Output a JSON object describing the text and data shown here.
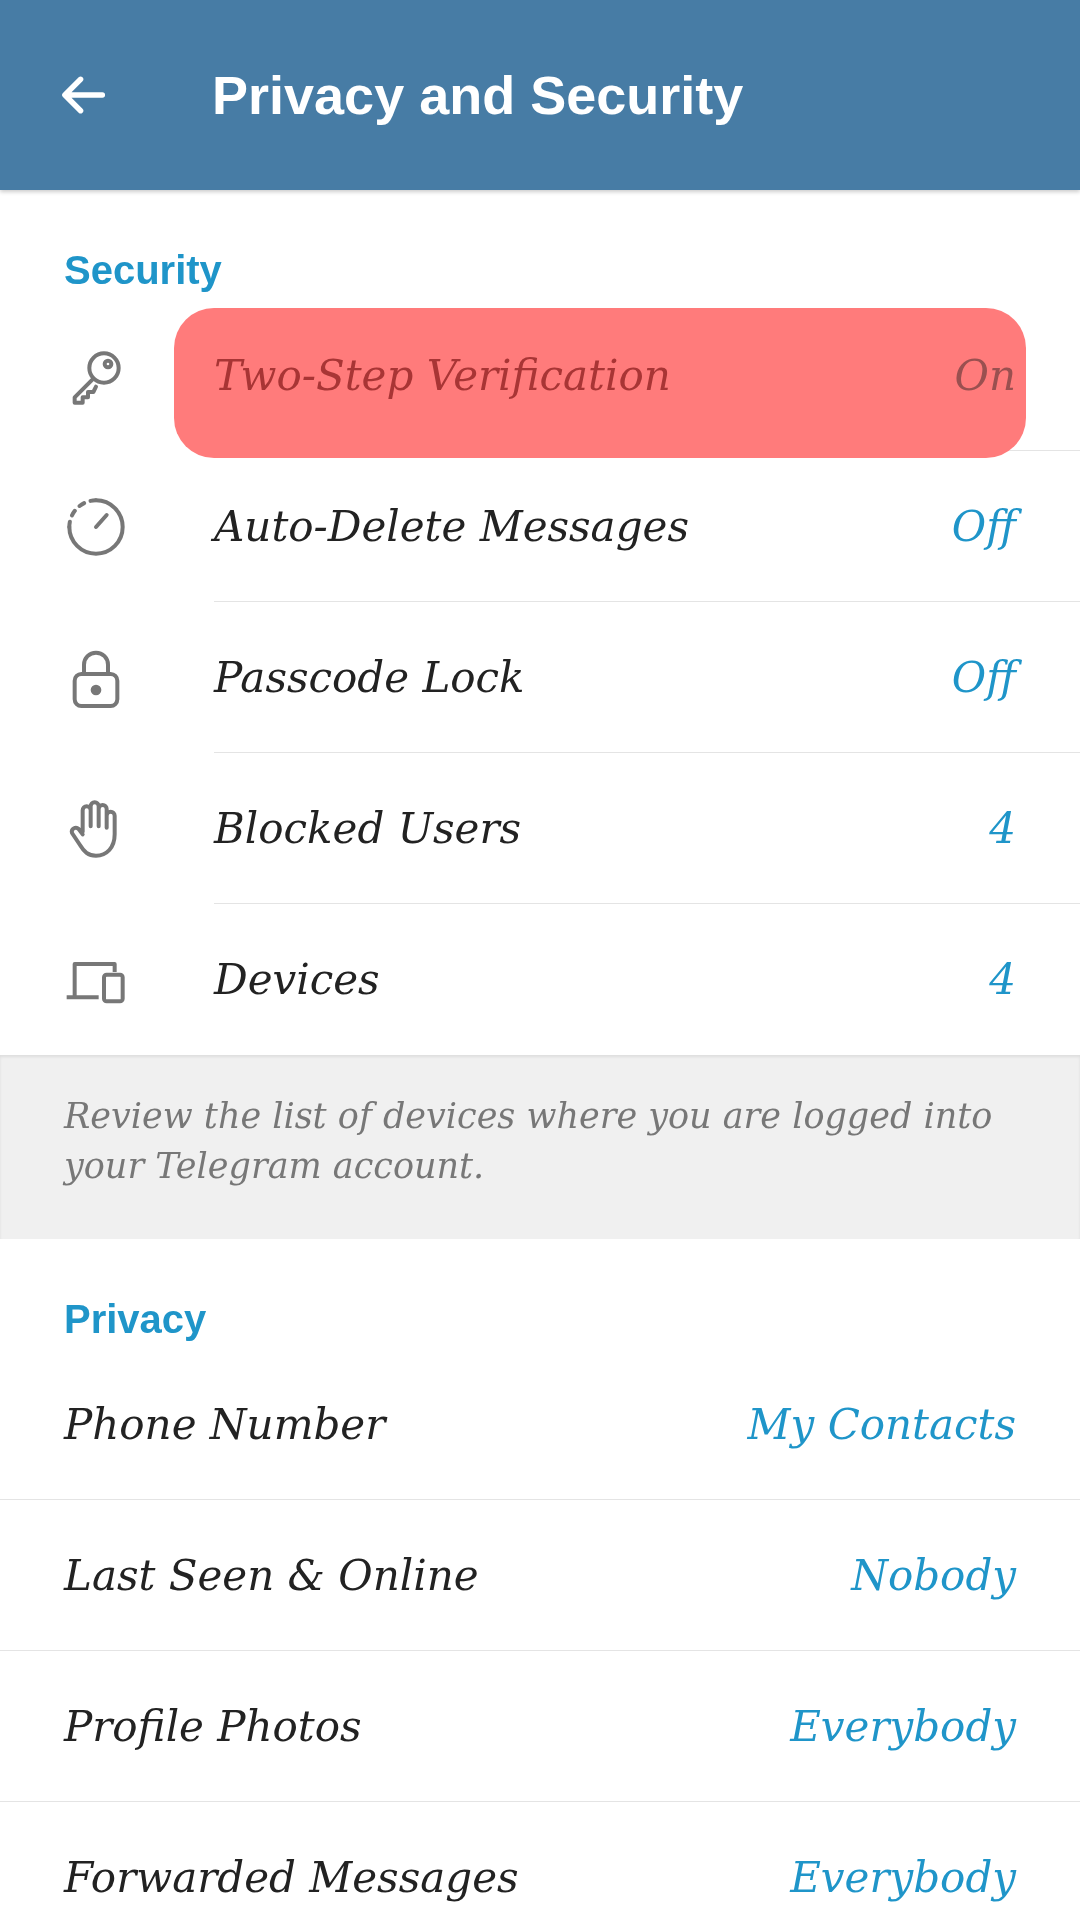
{
  "header": {
    "title": "Privacy and Security"
  },
  "sections": [
    {
      "title": "Security",
      "items": [
        {
          "kind": "key",
          "label": "Two-Step Verification",
          "value": "On",
          "highlighted": true
        },
        {
          "kind": "timer",
          "label": "Auto-Delete Messages",
          "value": "Off",
          "highlighted": false
        },
        {
          "kind": "lock",
          "label": "Passcode Lock",
          "value": "Off",
          "highlighted": false
        },
        {
          "kind": "hand",
          "label": "Blocked Users",
          "value": "4",
          "highlighted": false
        },
        {
          "kind": "devices",
          "label": "Devices",
          "value": "4",
          "highlighted": false
        }
      ],
      "footer": "Review the list of devices where you are logged into your Telegram account."
    },
    {
      "title": "Privacy",
      "items": [
        {
          "label": "Phone Number",
          "value": "My Contacts",
          "highlighted": false
        },
        {
          "label": "Last Seen & Online",
          "value": "Nobody",
          "highlighted": false
        },
        {
          "label": "Profile Photos",
          "value": "Everybody",
          "highlighted": false
        },
        {
          "label": "Forwarded Messages",
          "value": "Everybody",
          "highlighted": false
        }
      ]
    }
  ]
}
